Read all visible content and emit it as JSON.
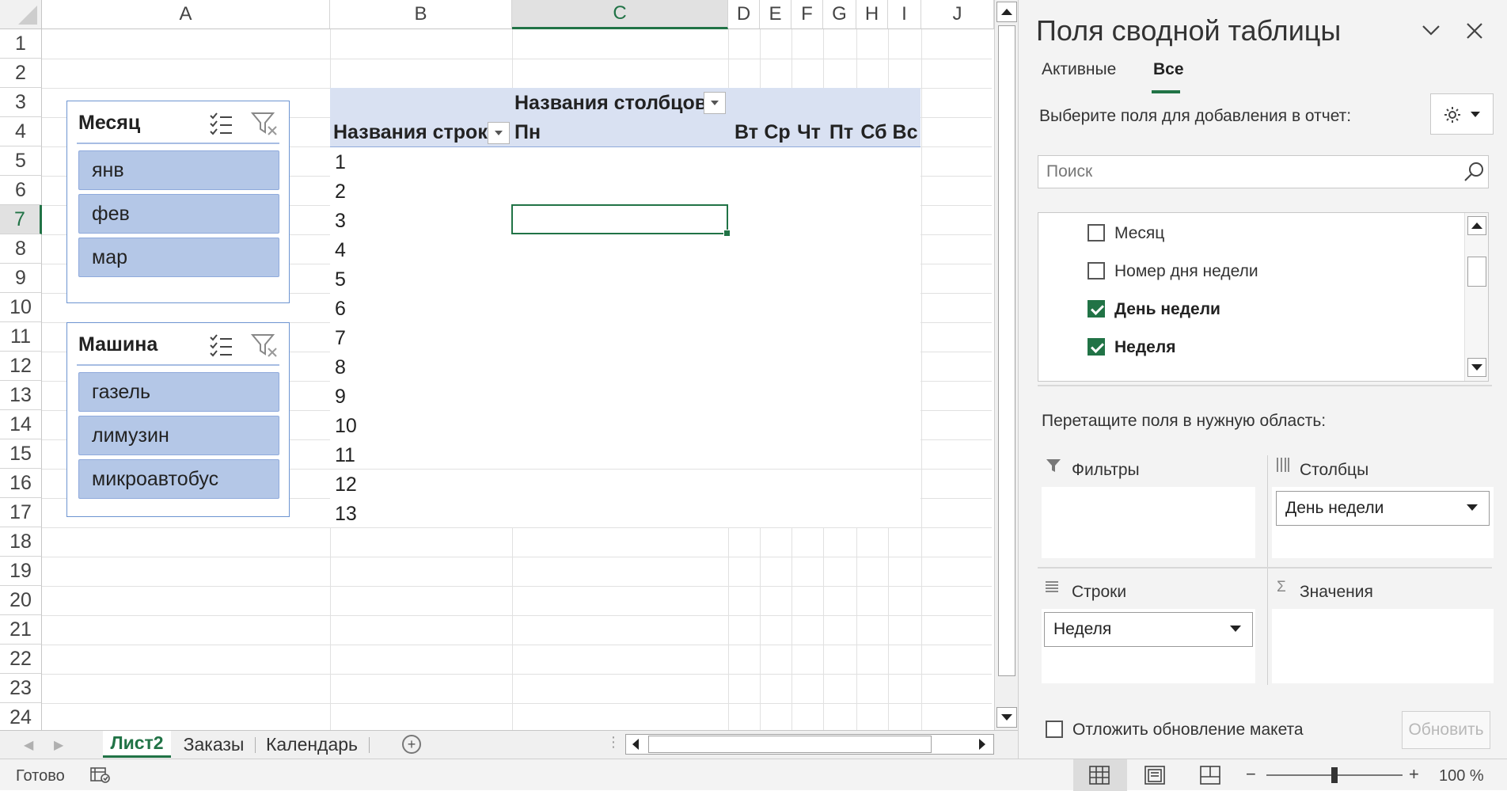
{
  "grid": {
    "columns": [
      "A",
      "B",
      "C",
      "D",
      "E",
      "F",
      "G",
      "H",
      "I",
      "J"
    ],
    "rows": [
      "1",
      "2",
      "3",
      "4",
      "5",
      "6",
      "7",
      "8",
      "9",
      "10",
      "11",
      "12",
      "13",
      "14",
      "15",
      "16",
      "17",
      "18",
      "19",
      "20",
      "21",
      "22",
      "23",
      "24"
    ],
    "selected_column": "C",
    "selected_row": "7"
  },
  "pivot": {
    "col_header_label": "Названия столбцов",
    "row_header_label": "Названия строк",
    "day_columns": [
      "Пн",
      "Вт",
      "Ср",
      "Чт",
      "Пт",
      "Сб",
      "Вс"
    ],
    "row_values": [
      "1",
      "2",
      "3",
      "4",
      "5",
      "6",
      "7",
      "8",
      "9",
      "10",
      "11",
      "12",
      "13"
    ]
  },
  "slicers": {
    "month": {
      "title": "Месяц",
      "items": [
        "янв",
        "фев",
        "мар"
      ]
    },
    "vehicle": {
      "title": "Машина",
      "items": [
        "газель",
        "лимузин",
        "микроавтобус"
      ]
    }
  },
  "sheet_tabs": {
    "tabs": [
      "Лист2",
      "Заказы",
      "Календарь"
    ],
    "active": "Лист2"
  },
  "status": {
    "ready": "Готово",
    "zoom": "100 %",
    "zoom_minus": "−",
    "zoom_plus": "+"
  },
  "pane": {
    "title": "Поля сводной таблицы",
    "tabs": [
      "Активные",
      "Все"
    ],
    "active_tab": "Все",
    "choose_fields": "Выберите поля для добавления в отчет:",
    "search_placeholder": "Поиск",
    "fields": [
      {
        "label": "Месяц",
        "checked": false
      },
      {
        "label": "Номер дня недели",
        "checked": false
      },
      {
        "label": "День недели",
        "checked": true
      },
      {
        "label": "Неделя",
        "checked": true
      }
    ],
    "drag_hint": "Перетащите поля в нужную область:",
    "areas": {
      "filters": {
        "label": "Фильтры"
      },
      "columns": {
        "label": "Столбцы",
        "chip": "День недели"
      },
      "rows": {
        "label": "Строки",
        "chip": "Неделя"
      },
      "values": {
        "label": "Значения"
      }
    },
    "defer_label": "Отложить обновление макета",
    "update_button": "Обновить"
  },
  "colors": {
    "accent_green": "#217346",
    "pivot_header": "#d9e1f2",
    "slicer_item": "#b4c7e7"
  }
}
